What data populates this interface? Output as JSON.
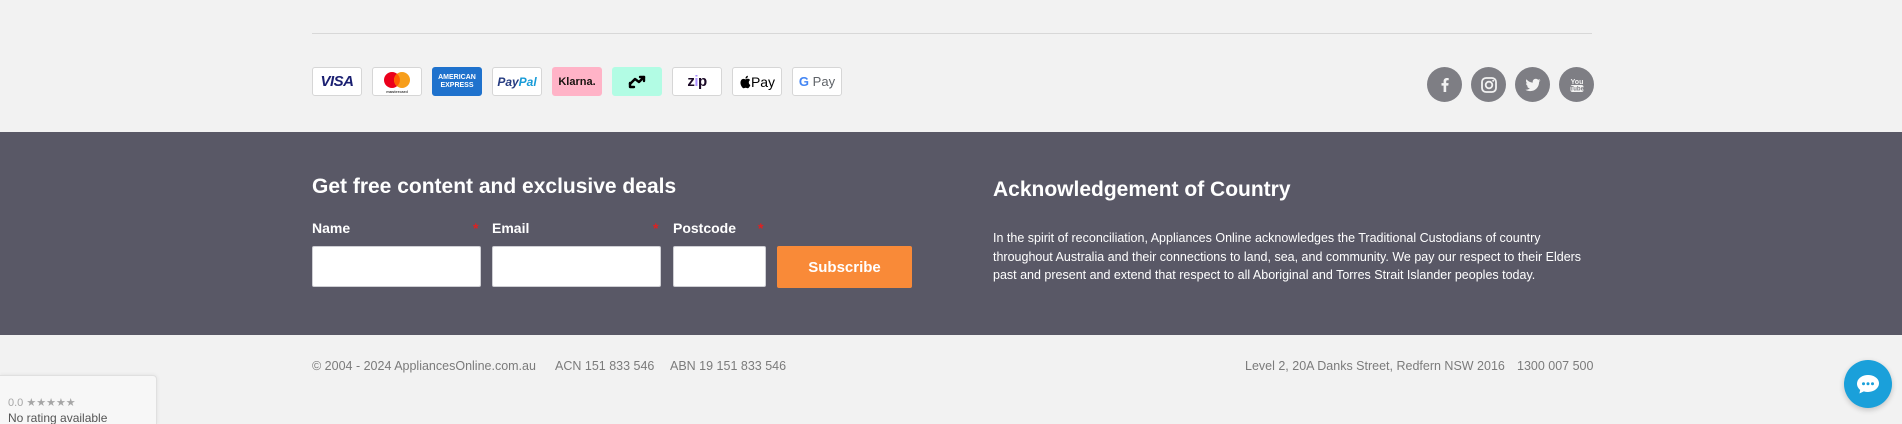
{
  "payments": {
    "visa": "VISA",
    "mastercard_caption": "mastercard",
    "amex_line1": "AMERICAN",
    "amex_line2": "EXPRESS",
    "paypal_pay": "Pay",
    "paypal_pal": "Pal",
    "klarna": "Klarna.",
    "zip_z": "z",
    "zip_i": "i",
    "zip_p": "p",
    "apple_pay": "Pay",
    "google_g": "G",
    "google_pay": "Pay"
  },
  "social_icons": [
    "facebook-icon",
    "instagram-icon",
    "twitter-icon",
    "youtube-icon"
  ],
  "newsletter": {
    "title": "Get free content and exclusive deals",
    "name_label": "Name",
    "email_label": "Email",
    "postcode_label": "Postcode",
    "required_marker": "*",
    "name_value": "",
    "email_value": "",
    "postcode_value": "",
    "subscribe_label": "Subscribe"
  },
  "acknowledgement": {
    "title": "Acknowledgement of Country",
    "text": "In the spirit of reconciliation, Appliances Online acknowledges the Traditional Custodians of country throughout Australia and their connections to land, sea, and community. We pay our respect to their Elders past and present and extend that respect to all Aboriginal and Torres Strait Islander peoples today."
  },
  "footer": {
    "copyright": "© 2004 - 2024 AppliancesOnline.com.au",
    "acn": "ACN 151 833 546",
    "abn": "ABN 19 151 833 546",
    "address": "Level 2, 20A Danks Street, Redfern NSW 2016",
    "phone": "1300 007 500"
  },
  "rating_widget": {
    "score": "0.0",
    "stars": "★★★★★",
    "status": "No rating available"
  },
  "colors": {
    "band": "#595866",
    "accent": "#f98a38",
    "chat": "#1aa0da"
  }
}
